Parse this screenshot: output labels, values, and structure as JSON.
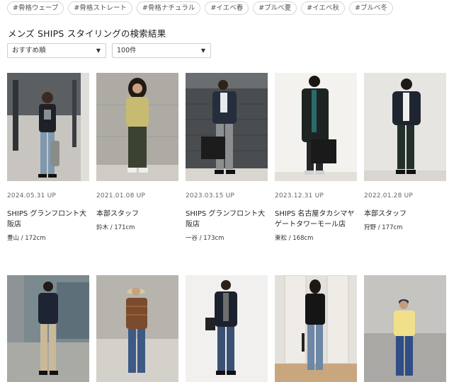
{
  "tags": [
    "#骨格ウェーブ",
    "#骨格ストレート",
    "#骨格ナチュラル",
    "#イエベ春",
    "#ブルベ夏",
    "#イエベ秋",
    "#ブルベ冬"
  ],
  "page_title": "メンズ SHIPS スタイリングの検索結果",
  "sort": {
    "value": "おすすめ順",
    "arrow": "▼"
  },
  "count": {
    "value": "100件",
    "arrow": "▼"
  },
  "row1": [
    {
      "date": "2024.05.31 UP",
      "shop": "SHIPS グランフロント大阪店",
      "staff": "豊山 / 172cm"
    },
    {
      "date": "2021.01.08 UP",
      "shop": "本部スタッフ",
      "staff": "鈴木 / 171cm"
    },
    {
      "date": "2023.03.15 UP",
      "shop": "SHIPS グランフロント大阪店",
      "staff": "一谷 / 173cm"
    },
    {
      "date": "2023.12.31 UP",
      "shop": "SHIPS 名古屋タカシマヤゲートタワーモール店",
      "staff": "東松 / 168cm"
    },
    {
      "date": "2022.01.28 UP",
      "shop": "本部スタッフ",
      "staff": "狩野 / 177cm"
    }
  ],
  "colors": {
    "accent_text": "#222222",
    "border": "#d7d7d7"
  }
}
